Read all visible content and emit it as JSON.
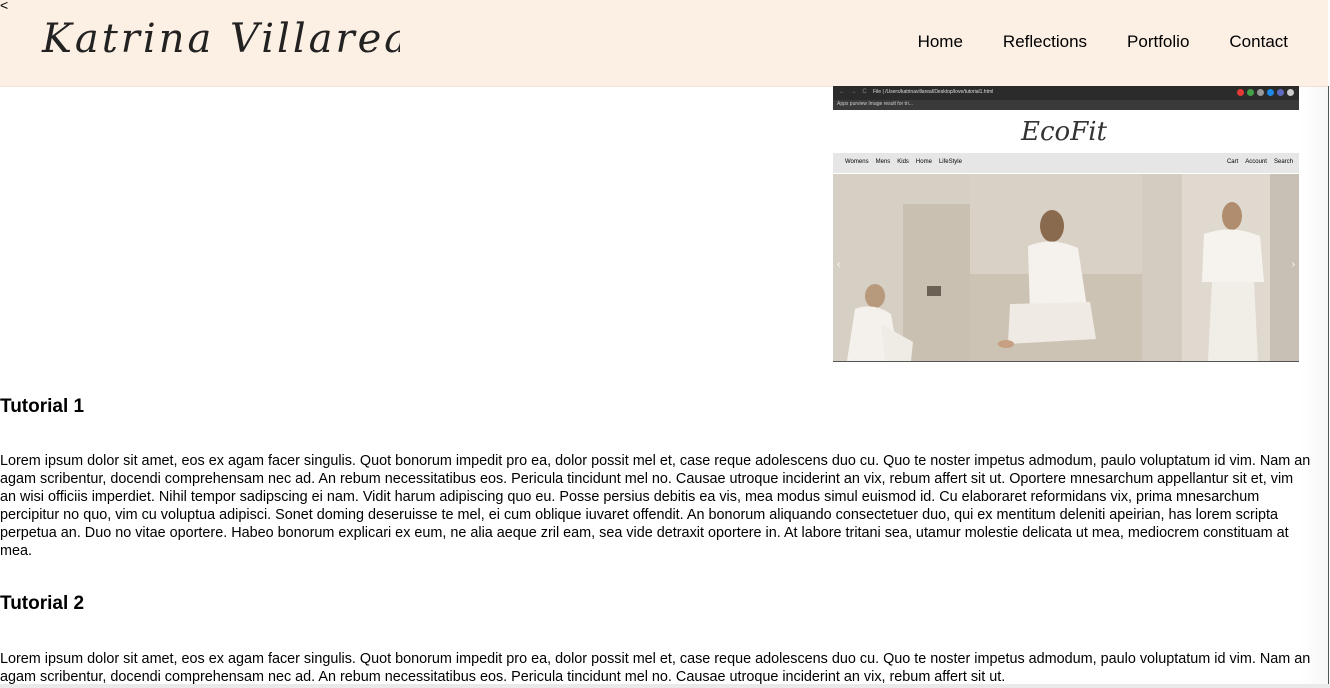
{
  "top_glyph": "<",
  "header": {
    "logo_text": "Katrina Villareal",
    "nav": [
      "Home",
      "Reflections",
      "Portfolio",
      "Contact"
    ]
  },
  "thumbnail": {
    "browser_url": "File | /Users/katrinavillareal/Desktop/love/tutorial1.html",
    "bookmarks": "Apps  purview  Image result for tri...",
    "brand": "EcoFit",
    "menu_left": [
      "Womens",
      "Mens",
      "Kids",
      "Home",
      "LifeStyle"
    ],
    "menu_right": [
      "Cart",
      "Account",
      "Search"
    ]
  },
  "tutorials": [
    {
      "title": "Tutorial 1",
      "body": "Lorem ipsum dolor sit amet, eos ex agam facer singulis. Quot bonorum impedit pro ea, dolor possit mel et, case reque adolescens duo cu. Quo te noster impetus admodum, paulo voluptatum id vim. Nam an agam scribentur, docendi comprehensam nec ad. An rebum necessitatibus eos. Pericula tincidunt mel no. Causae utroque inciderint an vix, rebum affert sit ut. Oportere mnesarchum appellantur sit et, vim an wisi officiis imperdiet. Nihil tempor sadipscing ei nam. Vidit harum adipiscing quo eu. Posse persius debitis ea vis, mea modus simul euismod id. Cu elaboraret reformidans vix, prima mnesarchum percipitur no quo, vim cu voluptua adipisci. Sonet doming deseruisse te mel, ei cum oblique iuvaret offendit. An bonorum aliquando consectetuer duo, qui ex mentitum deleniti apeirian, has lorem scripta perpetua an. Duo no vitae oportere. Habeo bonorum explicari ex eum, ne alia aeque zril eam, sea vide detraxit oportere in. At labore tritani sea, utamur molestie delicata ut mea, mediocrem constituam at mea."
    },
    {
      "title": "Tutorial 2",
      "body": "Lorem ipsum dolor sit amet, eos ex agam facer singulis. Quot bonorum impedit pro ea, dolor possit mel et, case reque adolescens duo cu. Quo te noster impetus admodum, paulo voluptatum id vim. Nam an agam scribentur, docendi comprehensam nec ad. An rebum necessitatibus eos. Pericula tincidunt mel no. Causae utroque inciderint an vix, rebum affert sit ut."
    }
  ]
}
